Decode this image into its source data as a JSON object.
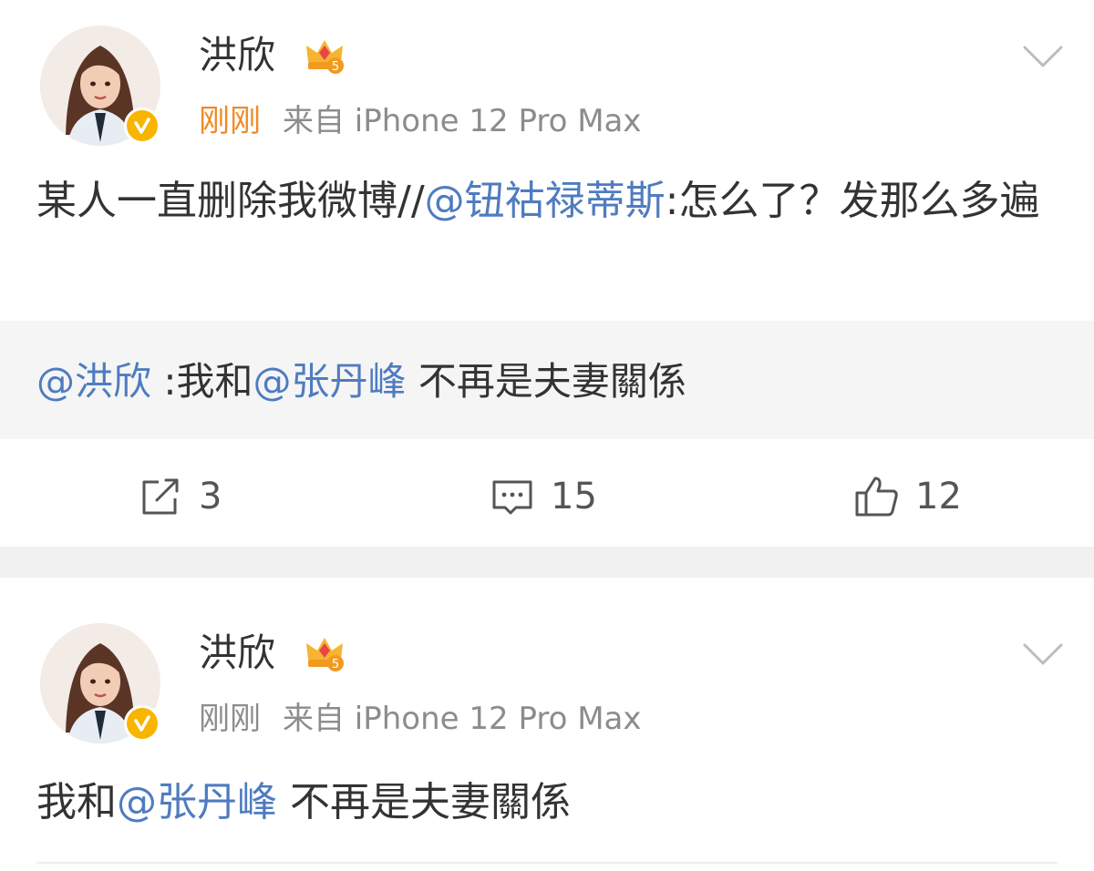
{
  "posts": [
    {
      "author": "洪欣",
      "time": "刚刚",
      "source": "来自 iPhone 12 Pro Max",
      "content": {
        "prefix": "某人一直删除我微博//",
        "mention": "@钮祜禄蒂斯",
        "suffix": ":怎么了？发那么多遍"
      },
      "quote": {
        "mention1": "@洪欣",
        "text1": " :我和",
        "mention2": "@张丹峰",
        "text2": " 不再是夫妻關係"
      },
      "actions": {
        "reposts": "3",
        "comments": "15",
        "likes": "12"
      },
      "icons": {
        "repost": "share-icon",
        "comment": "comment-icon",
        "like": "thumbs-up-icon",
        "more": "chevron-down-icon"
      }
    },
    {
      "author": "洪欣",
      "time": "刚刚",
      "source": "来自 iPhone 12 Pro Max",
      "content": {
        "prefix": "我和",
        "mention": "@张丹峰",
        "suffix": " 不再是夫妻關係"
      }
    }
  ],
  "colors": {
    "mention": "#4f7cbf",
    "time_highlight": "#f08a24",
    "verified_badge": "#f7b500",
    "divider": "#f1f1f1"
  }
}
